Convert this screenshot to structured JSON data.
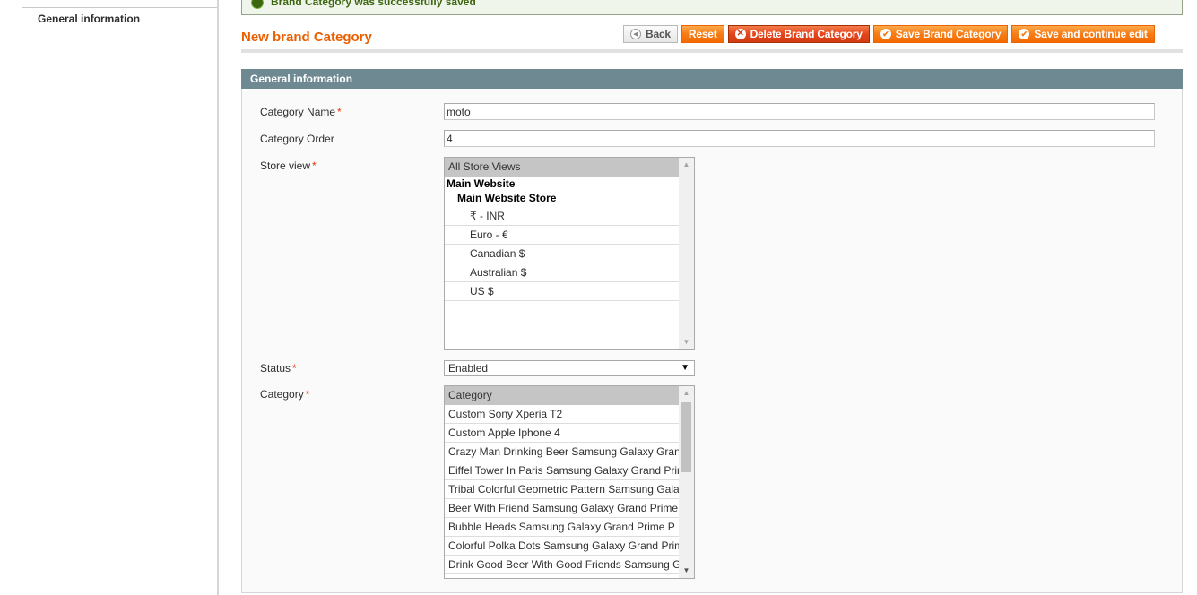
{
  "sidebar": {
    "tabs": [
      {
        "label": "General information",
        "active": true
      }
    ]
  },
  "message": {
    "type": "success",
    "text": "Brand Category was successfully saved"
  },
  "header": {
    "title": "New brand Category",
    "buttons": {
      "back": "Back",
      "reset": "Reset",
      "delete": "Delete Brand Category",
      "save": "Save Brand Category",
      "save_continue": "Save and continue edit"
    }
  },
  "section": {
    "title": "General information"
  },
  "form": {
    "category_name": {
      "label": "Category Name",
      "required": "*",
      "value": "moto"
    },
    "category_order": {
      "label": "Category Order",
      "value": "4"
    },
    "store_view": {
      "label": "Store view",
      "required": "*",
      "header_option": "All Store Views",
      "website": "Main Website",
      "store": "Main Website Store",
      "views": [
        "₹ - INR",
        "Euro - €",
        "Canadian $",
        "Australian $",
        "US $"
      ]
    },
    "status": {
      "label": "Status",
      "required": "*",
      "value": "Enabled"
    },
    "category": {
      "label": "Category",
      "required": "*",
      "header_option": "Category",
      "options": [
        "Custom Sony Xperia T2",
        "Custom Apple Iphone 4",
        "Crazy Man Drinking Beer Samsung Galaxy Grand Prime",
        "Eiffel Tower In Paris Samsung Galaxy Grand Prime",
        "Tribal Colorful Geometric Pattern Samsung Galaxy",
        "Beer With Friend Samsung Galaxy Grand Prime",
        "Bubble Heads Samsung Galaxy Grand Prime P",
        "Colorful Polka Dots Samsung Galaxy Grand Prime",
        "Drink Good Beer With Good Friends Samsung Galaxy"
      ]
    }
  },
  "colors": {
    "accent": "#eb5e00",
    "section_header": "#6f8992",
    "button_orange": "#f77c16",
    "button_delete": "#e4441b",
    "success_bg": "#eff5ea",
    "required": "#eb340a"
  }
}
